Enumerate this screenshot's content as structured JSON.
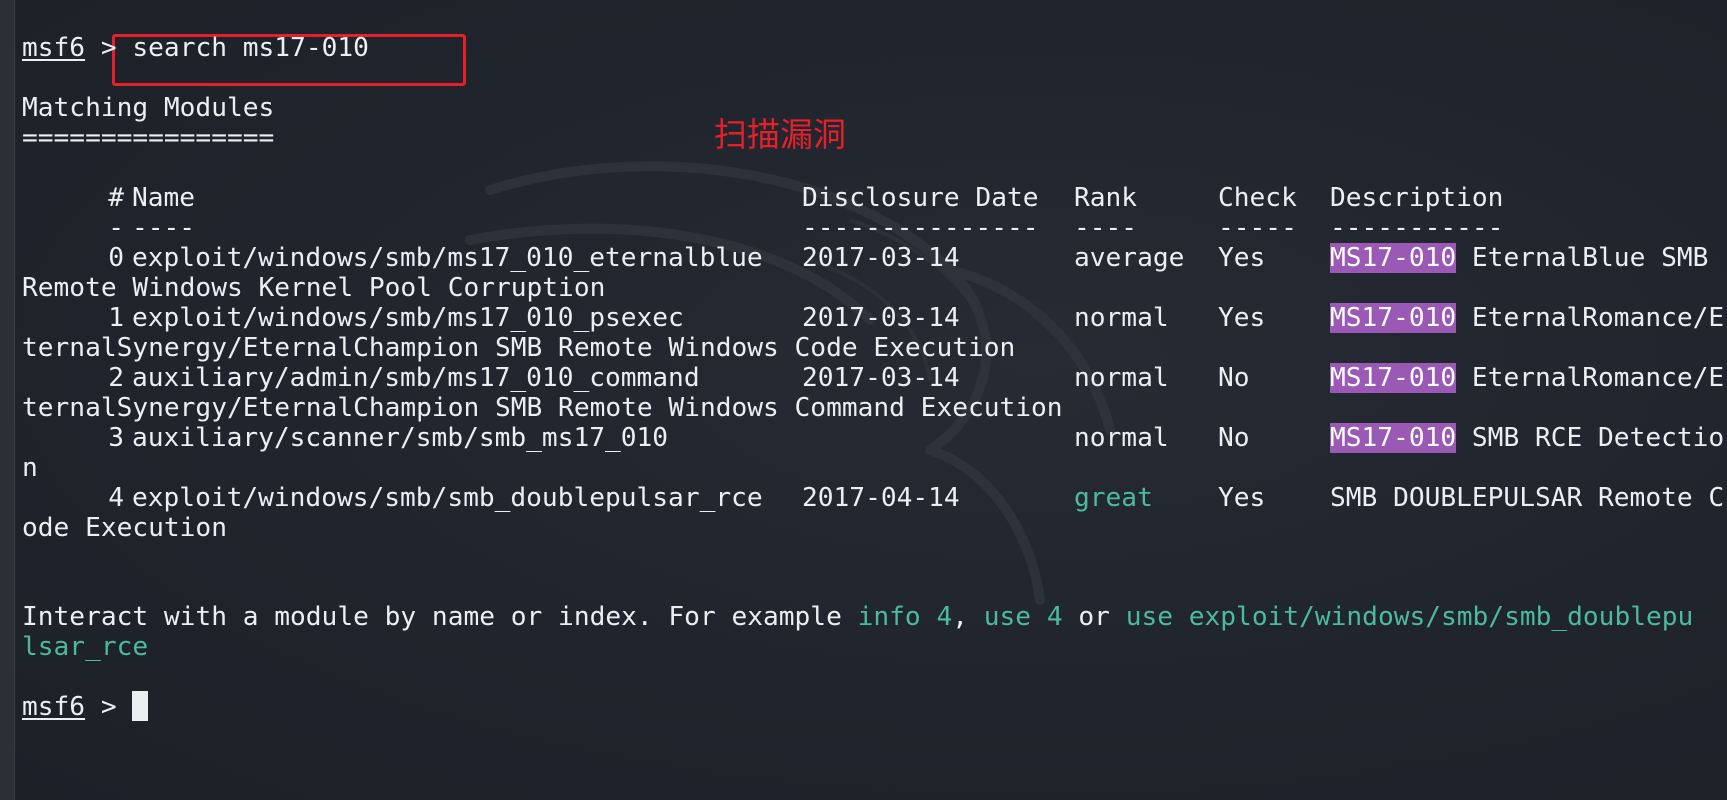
{
  "prompt": {
    "label": "msf6",
    "symbol": " > "
  },
  "command": {
    "text": "search ms17-010"
  },
  "annotation": {
    "text": "扫描漏洞"
  },
  "matching": {
    "title": "Matching Modules",
    "rule": "================"
  },
  "table": {
    "headers": {
      "num": "#",
      "name": "Name",
      "date": "Disclosure Date",
      "rank": "Rank",
      "check": "Check",
      "desc": "Description"
    },
    "dividers": {
      "num": "-",
      "name": "----",
      "date": "---------------",
      "rank": "----",
      "check": "-----",
      "desc": "-----------"
    },
    "rows": [
      {
        "num": "0",
        "name": "exploit/windows/smb/ms17_010_eternalblue",
        "date": "2017-03-14",
        "rank": "average",
        "check": "Yes",
        "hl": "MS17-010",
        "desc1": " EternalBlue SMB",
        "desc2": "Remote Windows Kernel Pool Corruption"
      },
      {
        "num": "1",
        "name": "exploit/windows/smb/ms17_010_psexec",
        "date": "2017-03-14",
        "rank": "normal",
        "check": "Yes",
        "hl": "MS17-010",
        "desc1": " EternalRomance/E",
        "desc2": "ternalSynergy/EternalChampion SMB Remote Windows Code Execution"
      },
      {
        "num": "2",
        "name": "auxiliary/admin/smb/ms17_010_command",
        "date": "2017-03-14",
        "rank": "normal",
        "check": "No",
        "hl": "MS17-010",
        "desc1": " EternalRomance/E",
        "desc2": "ternalSynergy/EternalChampion SMB Remote Windows Command Execution"
      },
      {
        "num": "3",
        "name": "auxiliary/scanner/smb/smb_ms17_010",
        "date": "",
        "rank": "normal",
        "check": "No",
        "hl": "MS17-010",
        "desc1": " SMB RCE Detectio",
        "desc2": "n"
      },
      {
        "num": "4",
        "name": "exploit/windows/smb/smb_doublepulsar_rce",
        "date": "2017-04-14",
        "rank": "great",
        "check": "Yes",
        "hl": "",
        "desc1": "SMB DOUBLEPULSAR Remote C",
        "desc2": "ode Execution"
      }
    ]
  },
  "interact": {
    "prefix": "Interact with a module by name or index. For example ",
    "ex1": "info 4",
    "sep1": ", ",
    "ex2": "use 4",
    "sep2": " or ",
    "ex3a": "use exploit/windows/smb/smb_doublepu",
    "ex3b": "lsar_rce"
  },
  "colors": {
    "accent": "#4cb9a1",
    "highlight": "#9b59b6",
    "annotation": "#e5202a",
    "text": "#eceff1",
    "background": "#20242c"
  }
}
